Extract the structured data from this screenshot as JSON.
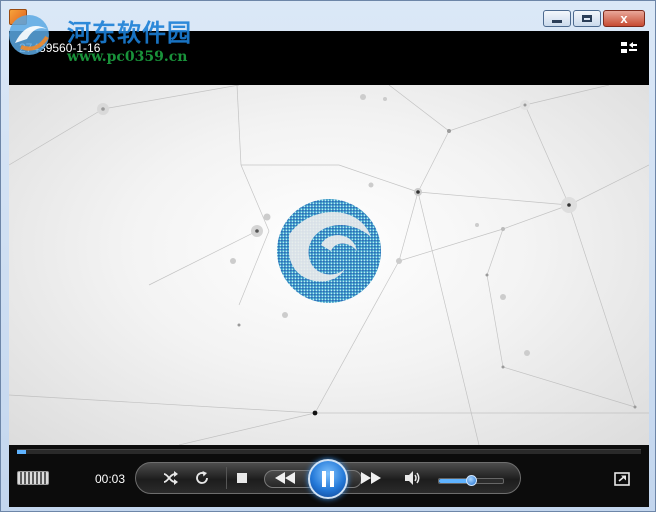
{
  "window": {
    "watermark_title": "河东软件园",
    "watermark_url": "www.pc0359.cn",
    "close_glyph": "x"
  },
  "player": {
    "video_title": "27439560-1-16",
    "elapsed_time": "00:03",
    "progress_fraction": 0.015,
    "volume_fraction": 0.5,
    "accent_color": "#2479d8",
    "icons": [
      "switch-to-library-icon",
      "fullscreen-toggle-icon",
      "shuffle-icon",
      "repeat-icon",
      "stop-icon",
      "previous-icon",
      "play-pause-icon",
      "next-icon",
      "volume-icon",
      "switch-to-now-playing-icon"
    ]
  }
}
